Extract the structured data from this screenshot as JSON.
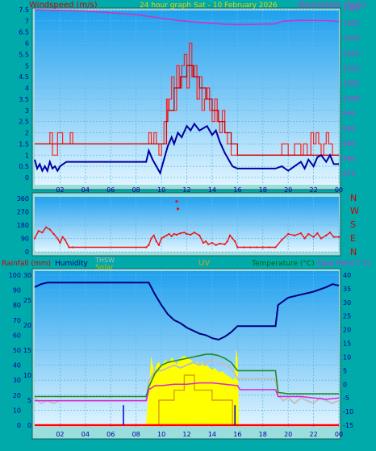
{
  "header": {
    "windspeed_label": "Windspeed (m/s)",
    "title": "24 hour graph Sat - 10 February 2026",
    "barometer_label": "Barometer (hpa)"
  },
  "compass": [
    "N",
    "W",
    "S",
    "E",
    "N"
  ],
  "bottom_header": {
    "rainfall": "Rainfall (mm)",
    "humidity": "Humidity",
    "thsw": "THSW",
    "solar": "Solar",
    "uv": "UV",
    "temperature": "Temperature (°C)",
    "dewpoint": "Dew Point (°C)"
  },
  "colors": {
    "background": "#00aaaa",
    "windspeed": "#ff2020",
    "gust": "#cc0000",
    "avg_wind": "#0000a0",
    "barometer": "#cc33cc",
    "direction": "#ee1111",
    "humidity": "#000080",
    "solar": "#ffff00",
    "temperature": "#228b22",
    "thsw": "#c0c0c0",
    "dewpoint": "#dd22dd",
    "rainfall_total": "#ff0000",
    "uv": "#d4a017"
  },
  "chart_data": [
    {
      "type": "line",
      "x_ticks": [
        "02",
        "04",
        "06",
        "08",
        "10",
        "12",
        "14",
        "16",
        "18",
        "20",
        "22",
        "00"
      ],
      "y_left_ticks": [
        "0",
        "0.5",
        "1",
        "1.5",
        "2",
        "2.5",
        "3",
        "3.5",
        "4",
        "4.5",
        "5",
        "5.5",
        "6",
        "6.5",
        "7",
        "7.5"
      ],
      "ylim_left": [
        0,
        7.75
      ],
      "y_right_ticks": [
        "975",
        "980",
        "985",
        "990",
        "995",
        "1000",
        "1005",
        "1010",
        "1015",
        "1020",
        "1025",
        "1030"
      ],
      "ylim_right": [
        973.7,
        1031.3
      ],
      "x_range_hours": [
        0,
        24
      ],
      "grid": true,
      "series": [
        {
          "name": "Windspeed",
          "axis": "left",
          "step": true,
          "x": [
            0,
            1.2,
            1.4,
            1.8,
            2.2,
            2.8,
            3,
            8.8,
            9,
            9.2,
            9.4,
            9.6,
            9.8,
            10,
            10.2,
            10.4,
            10.5,
            10.6,
            10.8,
            11,
            11.2,
            11.4,
            11.6,
            11.8,
            12,
            12.2,
            12.4,
            12.6,
            12.8,
            13,
            13.2,
            13.4,
            13.6,
            13.8,
            14,
            14.2,
            14.4,
            14.6,
            14.8,
            15,
            15.2,
            15.5,
            16,
            17,
            18,
            19,
            19.5,
            20,
            20.5,
            21,
            21.2,
            21.5,
            21.8,
            22,
            22.2,
            22.4,
            22.6,
            22.8,
            23,
            23.2,
            23.5,
            24
          ],
          "y": [
            1.5,
            2,
            1,
            2,
            1.5,
            2,
            1.5,
            1.5,
            2,
            1.5,
            2,
            1.5,
            1,
            1.5,
            2.5,
            3.5,
            3,
            3.5,
            4.5,
            3,
            5,
            4,
            5,
            5.5,
            4,
            6,
            4.5,
            5,
            3.5,
            4.5,
            3,
            3.5,
            4,
            3,
            2.5,
            3.5,
            2.5,
            2,
            3,
            2,
            1.5,
            1,
            1,
            1,
            1,
            1,
            1.5,
            1,
            1.5,
            1,
            1.5,
            1,
            2,
            1.5,
            2,
            1.5,
            1,
            1.5,
            2,
            1.5,
            1,
            1
          ]
        },
        {
          "name": "Gust",
          "axis": "left",
          "step": true,
          "x": [
            0,
            3,
            8.8,
            9,
            10,
            10.4,
            10.5,
            11,
            11.5,
            12,
            12.5,
            13,
            13.5,
            14,
            14.5,
            15,
            15.5,
            16,
            24
          ],
          "y": [
            1.5,
            1.5,
            1.5,
            1.5,
            1.5,
            2.5,
            3,
            4,
            4.5,
            5,
            4.5,
            4,
            3.5,
            3,
            2.5,
            2,
            1.5,
            1,
            1
          ]
        },
        {
          "name": "Average wind",
          "axis": "left",
          "x": [
            0,
            0.2,
            0.4,
            0.6,
            0.8,
            1,
            1.2,
            1.4,
            1.6,
            1.8,
            2,
            2.5,
            3,
            8.8,
            9,
            9.3,
            9.6,
            9.9,
            10.2,
            10.5,
            10.8,
            11,
            11.3,
            11.6,
            12,
            12.3,
            12.6,
            13,
            13.3,
            13.6,
            14,
            14.3,
            14.6,
            15,
            15.3,
            15.6,
            16,
            17,
            18,
            19,
            19.5,
            20,
            20.5,
            21,
            21.3,
            21.6,
            22,
            22.3,
            22.6,
            23,
            23.3,
            23.6,
            24
          ],
          "y": [
            0.8,
            0.4,
            0.6,
            0.3,
            0.5,
            0.3,
            0.7,
            0.4,
            0.5,
            0.3,
            0.5,
            0.7,
            0.7,
            0.7,
            1.2,
            0.8,
            0.5,
            0.2,
            0.8,
            1.4,
            1.8,
            1.5,
            2,
            1.8,
            2.3,
            2.1,
            2.4,
            2.1,
            2.2,
            2.3,
            1.9,
            2.1,
            1.6,
            1.1,
            0.8,
            0.5,
            0.4,
            0.4,
            0.4,
            0.4,
            0.5,
            0.3,
            0.5,
            0.7,
            0.4,
            0.8,
            0.5,
            0.9,
            1,
            0.7,
            1,
            0.6,
            0.6
          ]
        },
        {
          "name": "Barometer",
          "axis": "right",
          "x": [
            0,
            4,
            8,
            11,
            13,
            15,
            16,
            18,
            19,
            19.5,
            21,
            23,
            24
          ],
          "y": [
            1029.4,
            1029,
            1027.8,
            1026,
            1025.2,
            1024.6,
            1024.5,
            1024.6,
            1024.7,
            1025.6,
            1025.9,
            1025.8,
            1025.5
          ]
        }
      ]
    },
    {
      "type": "scatter",
      "y_ticks": [
        "0",
        "90",
        "180",
        "270",
        "360"
      ],
      "ylim": [
        0,
        360
      ],
      "series": [
        {
          "name": "Wind direction",
          "x": [
            0,
            0.3,
            0.6,
            0.9,
            1.2,
            1.5,
            1.8,
            2,
            2.2,
            2.4,
            2.7,
            3,
            8.8,
            9,
            9.2,
            9.4,
            9.6,
            9.8,
            10,
            10.2,
            10.4,
            10.6,
            10.8,
            11,
            11.2,
            11.5,
            11.8,
            12,
            12.3,
            12.6,
            13,
            13.3,
            13.5,
            13.7,
            14,
            14.3,
            14.6,
            15,
            15.2,
            15.4,
            15.6,
            15.8,
            16,
            16.5,
            17,
            17.5,
            18,
            18.5,
            19,
            19.5,
            20,
            20.5,
            21,
            21.3,
            21.6,
            22,
            22.3,
            22.6,
            23,
            23.3,
            23.6,
            24
          ],
          "y": [
            90,
            140,
            130,
            165,
            150,
            120,
            90,
            60,
            100,
            80,
            30,
            30,
            30,
            45,
            90,
            110,
            70,
            45,
            90,
            100,
            110,
            120,
            105,
            120,
            115,
            125,
            130,
            120,
            115,
            130,
            110,
            60,
            70,
            50,
            60,
            45,
            55,
            50,
            70,
            110,
            90,
            70,
            30,
            30,
            30,
            30,
            30,
            30,
            30,
            80,
            120,
            110,
            125,
            90,
            120,
            100,
            125,
            90,
            110,
            130,
            100,
            100
          ]
        },
        {
          "name": "Wind direction marks",
          "x": [
            11.2,
            11.3
          ],
          "y": [
            340,
            290
          ]
        }
      ]
    },
    {
      "type": "line",
      "x_ticks": [
        "02",
        "04",
        "06",
        "08",
        "10",
        "12",
        "14",
        "16",
        "18",
        "20",
        "22",
        "00"
      ],
      "y_left_ticks": [
        "0",
        "10",
        "20",
        "30",
        "40",
        "50",
        "60",
        "70",
        "80",
        "90",
        "100"
      ],
      "ylim_left": [
        0,
        100
      ],
      "y_rain_ticks": [
        "0",
        "5",
        "10",
        "15",
        "20",
        "25",
        "30"
      ],
      "y_right_ticks": [
        "-15",
        "-10",
        "-5",
        "0",
        "5",
        "10",
        "15",
        "20",
        "25",
        "30",
        "35",
        "40"
      ],
      "ylim_right": [
        -15,
        40
      ],
      "series": [
        {
          "name": "Humidity",
          "axis": "left",
          "x": [
            0,
            0.5,
            1,
            2,
            8,
            9,
            9.5,
            10,
            10.5,
            11,
            11.5,
            12,
            12.5,
            13,
            13.5,
            14,
            14.5,
            15,
            15.5,
            16,
            18,
            19,
            19.2,
            19.5,
            20,
            21,
            22,
            23,
            23.5,
            24
          ],
          "y": [
            92,
            94,
            95,
            95,
            95,
            95,
            87,
            80,
            74,
            70,
            68,
            65,
            63,
            61,
            60,
            58,
            57,
            59,
            62,
            66,
            66,
            66,
            80,
            82,
            85,
            87,
            89,
            92,
            94,
            93
          ]
        },
        {
          "name": "Solar",
          "axis": "left",
          "area": true,
          "x": [
            0,
            8.7,
            8.8,
            9,
            9.2,
            9.4,
            9.6,
            9.8,
            10,
            10.2,
            10.4,
            10.6,
            10.8,
            11,
            11.2,
            11.4,
            11.6,
            11.8,
            12,
            12.2,
            12.4,
            12.6,
            12.8,
            13,
            13.2,
            13.4,
            13.6,
            13.8,
            14,
            14.2,
            14.4,
            14.6,
            14.8,
            15,
            15.2,
            15.4,
            15.6,
            15.8,
            15.9,
            16,
            16.1,
            24
          ],
          "y": [
            0,
            0,
            0,
            20,
            45,
            35,
            40,
            42,
            38,
            42,
            43,
            41,
            45,
            43,
            40,
            44,
            45,
            46,
            45,
            44,
            43,
            41,
            42,
            40,
            42,
            39,
            40,
            38,
            37,
            38,
            36,
            35,
            36,
            34,
            33,
            32,
            30,
            31,
            50,
            45,
            0,
            0
          ]
        },
        {
          "name": "Temperature",
          "axis": "right",
          "x": [
            0,
            8.8,
            9,
            9.5,
            10,
            10.5,
            11,
            11.5,
            12,
            12.5,
            13,
            13.5,
            14,
            14.5,
            15,
            15.5,
            16,
            18,
            19,
            19.2,
            20,
            21,
            22,
            23,
            24
          ],
          "y": [
            -4.5,
            -4.5,
            -1,
            4,
            7,
            8,
            8.5,
            9,
            9.5,
            10,
            10.5,
            11,
            11,
            10.5,
            9.5,
            8,
            5,
            5,
            5,
            -3,
            -3.5,
            -3.5,
            -3.5,
            -3.5,
            -3.5
          ]
        },
        {
          "name": "THSW",
          "axis": "right",
          "x": [
            0,
            0.5,
            1,
            1.5,
            2,
            3,
            8.8,
            9,
            9.5,
            10,
            10.5,
            11,
            11.5,
            12,
            12.5,
            13,
            13.5,
            14,
            14.5,
            15,
            15.5,
            16,
            19,
            19.2,
            19.6,
            20,
            20.5,
            21,
            21.5,
            22,
            22.5,
            23,
            23.5,
            24
          ],
          "y": [
            -5,
            -7,
            -6,
            -7,
            -6,
            -6,
            -6,
            1,
            5,
            5,
            6,
            7,
            6,
            7,
            8,
            7,
            8,
            9,
            8,
            7,
            6,
            2,
            2,
            -4,
            -6,
            -5,
            -7,
            -5,
            -6,
            -7,
            -5,
            -6,
            -7,
            -6
          ]
        },
        {
          "name": "Dew Point",
          "axis": "right",
          "x": [
            0,
            8.8,
            9,
            9.5,
            10,
            11,
            12,
            13,
            14,
            15,
            16,
            16.2,
            19,
            19.2,
            20,
            21,
            22,
            23,
            24
          ],
          "y": [
            -6,
            -6,
            -2,
            -0.5,
            -0.5,
            0,
            0,
            0.5,
            0.5,
            0,
            -0.5,
            -2,
            -2,
            -4.5,
            -4.5,
            -4.5,
            -5,
            -5.5,
            -5
          ]
        },
        {
          "name": "UV",
          "axis": "rain",
          "step": true,
          "x": [
            0,
            9.6,
            9.8,
            11,
            11.8,
            12.6,
            14,
            15.6,
            24
          ],
          "y": [
            0,
            0,
            5,
            7,
            10,
            7,
            5,
            0,
            0
          ]
        },
        {
          "name": "Rainfall",
          "axis": "rain",
          "x": [
            0,
            24
          ],
          "y": [
            0,
            0
          ]
        }
      ],
      "bars": {
        "name": "Blue marks",
        "x": [
          7,
          15.8
        ],
        "y": [
          4,
          4
        ]
      }
    }
  ]
}
